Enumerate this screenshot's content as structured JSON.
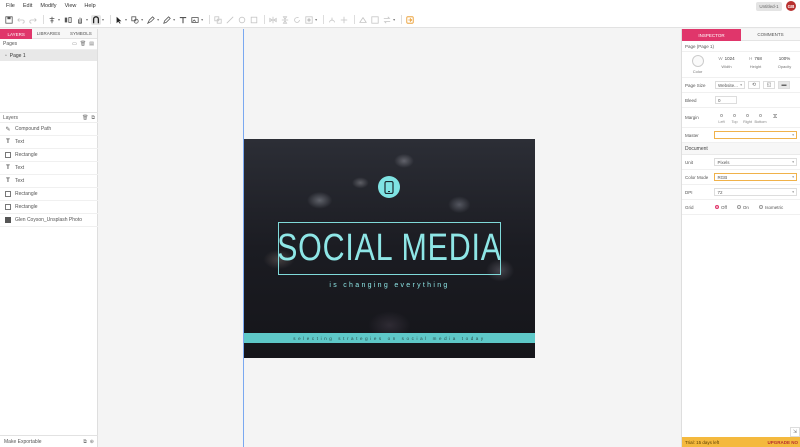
{
  "menubar": {
    "items": [
      "File",
      "Edit",
      "Modify",
      "View",
      "Help"
    ],
    "doc_title": "Untitled-1",
    "user_initials": "GB"
  },
  "left_panel": {
    "tabs": [
      "LAYERS",
      "LIBRARIES",
      "SYMBOLS"
    ],
    "pages_label": "Pages",
    "pages": [
      "Page 1"
    ],
    "layers_label": "Layers",
    "layers": [
      {
        "name": "Compound Path",
        "icon": "pen-icon"
      },
      {
        "name": "Text",
        "icon": "text-icon"
      },
      {
        "name": "Rectangle",
        "icon": "rectangle-icon"
      },
      {
        "name": "Text",
        "icon": "text-icon"
      },
      {
        "name": "Text",
        "icon": "text-icon"
      },
      {
        "name": "Rectangle",
        "icon": "rectangle-icon"
      },
      {
        "name": "Rectangle",
        "icon": "rectangle-icon"
      },
      {
        "name": "Glen Coyson_Unsplash Photo",
        "icon": "image-icon"
      }
    ],
    "make_exportable": "Make Exportable"
  },
  "artboard": {
    "title": "SOCIAL MEDIA",
    "subtitle": "is changing everything",
    "band_text": "selecting strategies on social media today",
    "accent": "#8ee6e6"
  },
  "inspector": {
    "tabs": [
      "INSPECTOR",
      "COMMENTS"
    ],
    "page_heading": "Page (Page 1)",
    "color_label": "Color",
    "width_value": "1024",
    "width_label": "Width",
    "height_value": "768",
    "height_label": "Height",
    "opacity_value": "100%",
    "opacity_label": "Opacity",
    "page_size_label": "Page Size",
    "page_size_value": "Website...",
    "bleed_label": "Bleed",
    "bleed_value": "0",
    "margin_label": "Margin",
    "margins": [
      {
        "label": "Left",
        "value": "0"
      },
      {
        "label": "Top",
        "value": "0"
      },
      {
        "label": "Right",
        "value": "0"
      },
      {
        "label": "Bottom",
        "value": "0"
      }
    ],
    "master_label": "Master",
    "document_label": "Document",
    "unit_label": "Unit",
    "unit_value": "Pixels",
    "color_mode_label": "Color Mode",
    "color_mode_value": "RGB",
    "dpi_label": "DPI",
    "dpi_value": "72",
    "grid_label": "Grid",
    "grid_options": [
      "Off",
      "On",
      "Isometric"
    ],
    "grid_selected": "Off",
    "trial_text": "Trial: 15 days left",
    "upgrade_text": "UPGRADE NO"
  }
}
